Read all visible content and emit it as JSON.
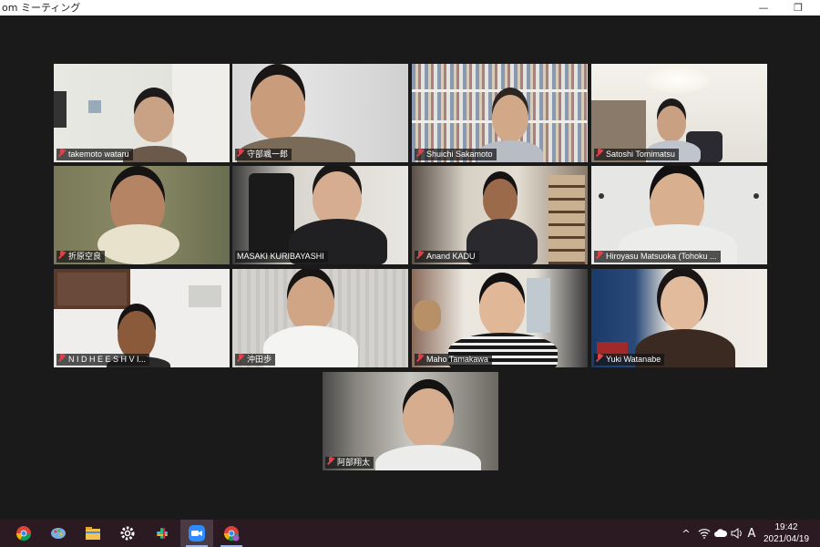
{
  "window": {
    "title": "om ミーティング",
    "minimize_glyph": "—",
    "restore_glyph": "❐"
  },
  "participants": [
    {
      "name": "takemoto wataru",
      "muted": true
    },
    {
      "name": "守部颯一郎",
      "muted": true
    },
    {
      "name": "Shuichi Sakamoto",
      "muted": true
    },
    {
      "name": "Satoshi Tomimatsu",
      "muted": true
    },
    {
      "name": "折原空良",
      "muted": true
    },
    {
      "name": "MASAKI KURIBAYASHI",
      "muted": false,
      "active_speaker": true
    },
    {
      "name": "Anand KADU",
      "muted": true
    },
    {
      "name": "Hiroyasu Matsuoka (Tohoku ...",
      "muted": true
    },
    {
      "name": "N I D H E E S H  V I...",
      "muted": true
    },
    {
      "name": "沖田歩",
      "muted": true
    },
    {
      "name": "Maho Tamakawa",
      "muted": true
    },
    {
      "name": "Yuki Watanabe",
      "muted": true
    },
    {
      "name": "阿部翔太",
      "muted": true
    }
  ],
  "taskbar": {
    "apps": [
      "chrome-icon",
      "paint-icon",
      "file-explorer-icon",
      "settings-icon",
      "slack-icon",
      "zoom-icon",
      "chrome-profile-icon"
    ],
    "tray": {
      "chevron": "^",
      "ime_indicator": "A",
      "time": "19:42",
      "date": "2021/04/19"
    }
  },
  "colors": {
    "active_speaker_outline": "#d7ee36",
    "muted_icon": "#e0414a",
    "background": "#1a1a1a",
    "taskbar": "#2b1a22"
  }
}
